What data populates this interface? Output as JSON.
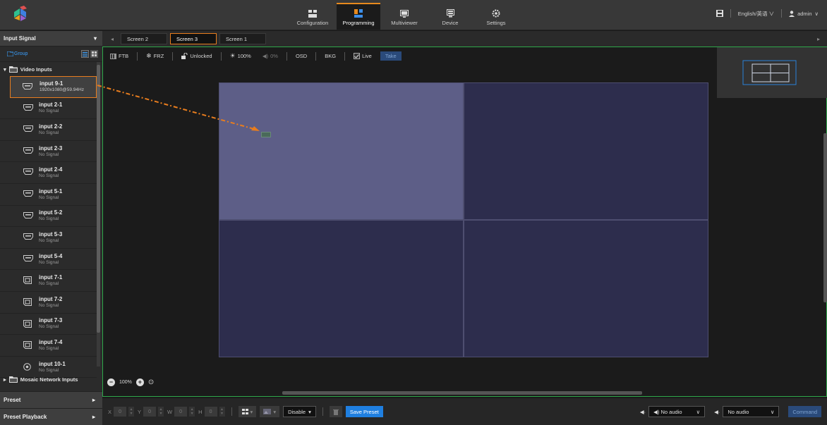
{
  "nav": {
    "items": [
      {
        "label": "Configuration",
        "icon": "grid-icon"
      },
      {
        "label": "Programming",
        "icon": "layout-icon"
      },
      {
        "label": "Multiviewer",
        "icon": "monitor-icon"
      },
      {
        "label": "Device",
        "icon": "device-icon"
      },
      {
        "label": "Settings",
        "icon": "gear-icon"
      }
    ],
    "active": "Programming"
  },
  "topright": {
    "language": "English/英语",
    "user": "admin"
  },
  "sidebar": {
    "title": "Input Signal",
    "group_label": "Group",
    "tree_title": "Video Inputs",
    "inputs": [
      {
        "name": "input 9-1",
        "status": "1920x1080@59.94Hz",
        "icon": "hdmi-icon"
      },
      {
        "name": "input 2-1",
        "status": "No Signal",
        "icon": "hdmi-icon"
      },
      {
        "name": "input 2-2",
        "status": "No Signal",
        "icon": "hdmi-icon"
      },
      {
        "name": "input 2-3",
        "status": "No Signal",
        "icon": "hdmi-icon"
      },
      {
        "name": "input 2-4",
        "status": "No Signal",
        "icon": "hdmi-icon"
      },
      {
        "name": "input 5-1",
        "status": "No Signal",
        "icon": "hdmi-icon"
      },
      {
        "name": "input 5-2",
        "status": "No Signal",
        "icon": "hdmi-icon"
      },
      {
        "name": "input 5-3",
        "status": "No Signal",
        "icon": "hdmi-icon"
      },
      {
        "name": "input 5-4",
        "status": "No Signal",
        "icon": "hdmi-icon"
      },
      {
        "name": "input 7-1",
        "status": "No Signal",
        "icon": "dp-icon"
      },
      {
        "name": "input 7-2",
        "status": "No Signal",
        "icon": "dp-icon"
      },
      {
        "name": "input 7-3",
        "status": "No Signal",
        "icon": "dp-icon"
      },
      {
        "name": "input 7-4",
        "status": "No Signal",
        "icon": "dp-icon"
      },
      {
        "name": "input 10-1",
        "status": "No Signal",
        "icon": "ip-icon"
      }
    ],
    "mosaic_label": "Mosaic Network Inputs",
    "footer": [
      "Preset",
      "Preset Playback"
    ]
  },
  "tabs": [
    "Screen 2",
    "Screen 3",
    "Screen 1"
  ],
  "active_tab": "Screen 3",
  "toolbar": {
    "ftb": "FTB",
    "frz": "FRZ",
    "lock": "Unlocked",
    "brightness": "100%",
    "volume": "0%",
    "osd": "OSD",
    "bkg": "BKG",
    "live": "Live",
    "take": "Take"
  },
  "zoom": {
    "level": "100%"
  },
  "bottom": {
    "x_label": "X",
    "x_value": "0",
    "y_label": "Y",
    "y_value": "0",
    "w_label": "W",
    "w_value": "0",
    "h_label": "H",
    "h_value": "0",
    "mode": "Disable",
    "save_preset": "Save Preset",
    "audio1": "No audio",
    "audio2": "No audio",
    "command": "Command"
  },
  "colors": {
    "accent": "#e87d1e",
    "border_green": "#2fa84a",
    "button_blue": "#1f7fe0",
    "canvas_bg": "#2d2d4d",
    "cell_active": "#5d5e87"
  }
}
